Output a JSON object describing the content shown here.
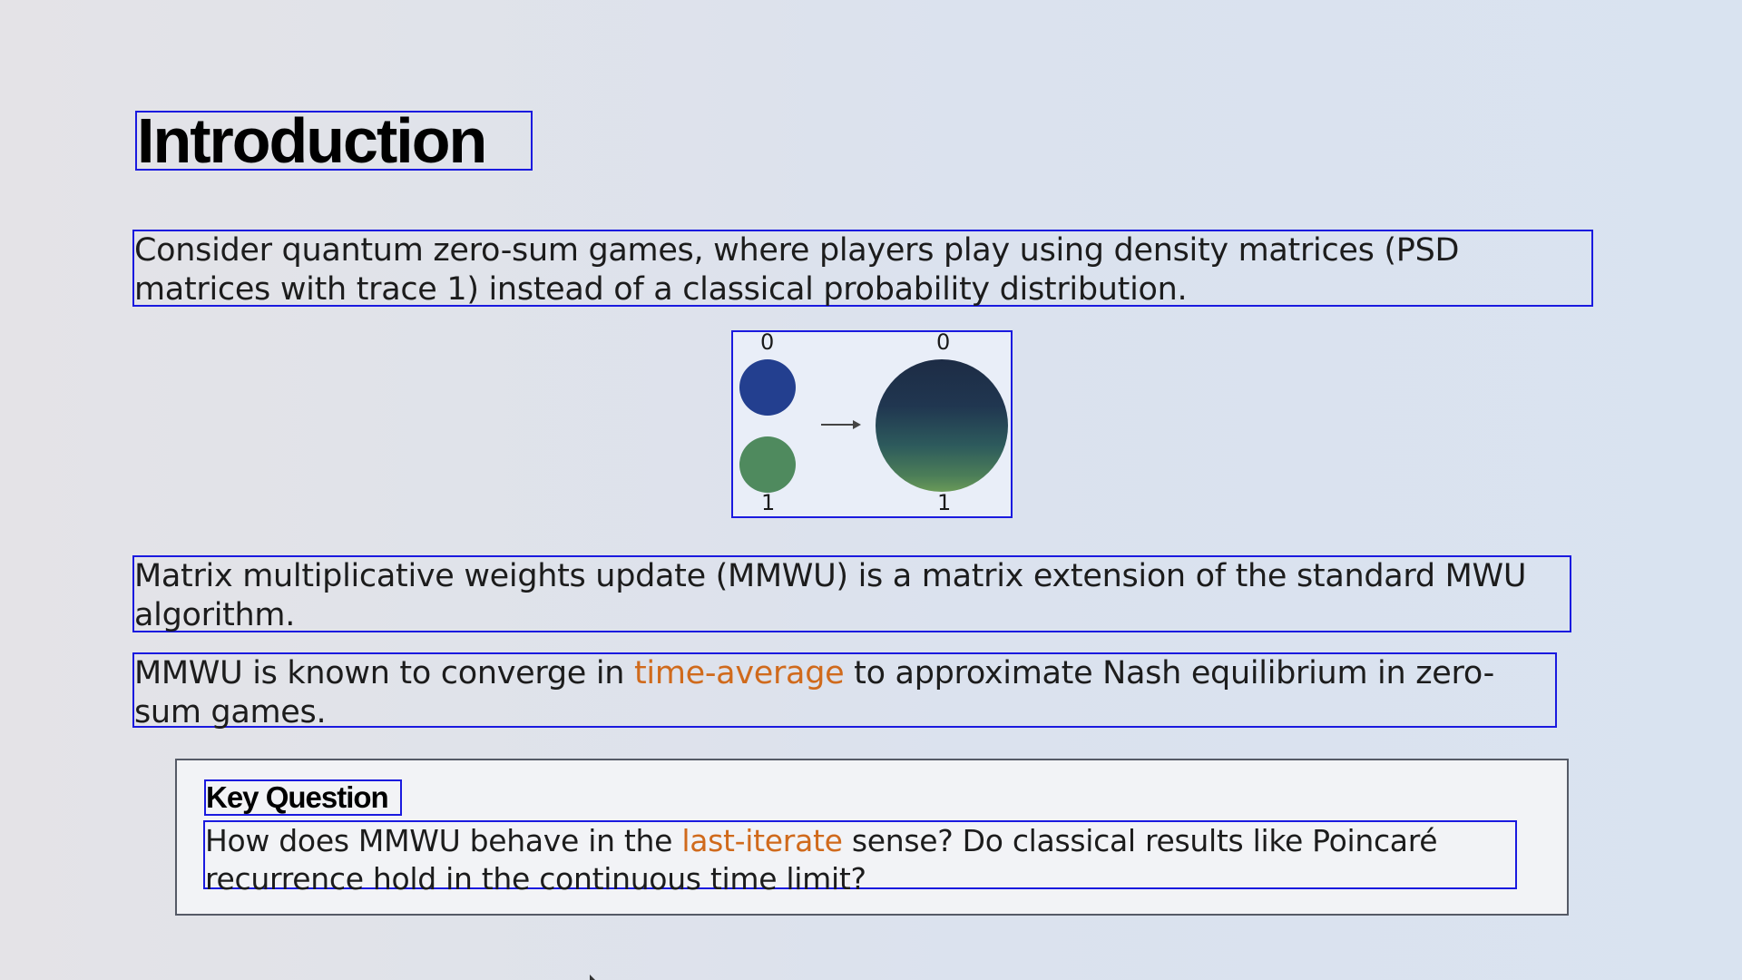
{
  "slide": {
    "title": "Introduction",
    "paragraph1": "Consider quantum zero-sum games, where players play using density matrices (PSD matrices with trace 1) instead of a classical probability distribution.",
    "paragraph2": "Matrix multiplicative weights update (MMWU) is a matrix extension of the standard MWU algorithm.",
    "paragraph3": {
      "before": "MMWU is known to converge in ",
      "highlight": "time-average",
      "after": " to approximate Nash equilibrium in zero-sum games."
    },
    "figure": {
      "left_top_label": "0",
      "left_bottom_label": "1",
      "right_top_label": "0",
      "right_bottom_label": "1",
      "arrow_icon": "right-arrow-icon",
      "colors": {
        "state0": "#233f8f",
        "state1": "#4f8a5e",
        "superposition_top": "#1d2c45",
        "superposition_bottom": "#6a9a58"
      }
    },
    "key_question": {
      "heading": "Key Question",
      "before": "How does MMWU behave in the ",
      "highlight": "last-iterate",
      "after": " sense? Do classical results like Poincaré recurrence hold in the continuous time limit?"
    },
    "colors": {
      "highlight": "#d06a1c",
      "bbox": "#1a1adf"
    }
  }
}
